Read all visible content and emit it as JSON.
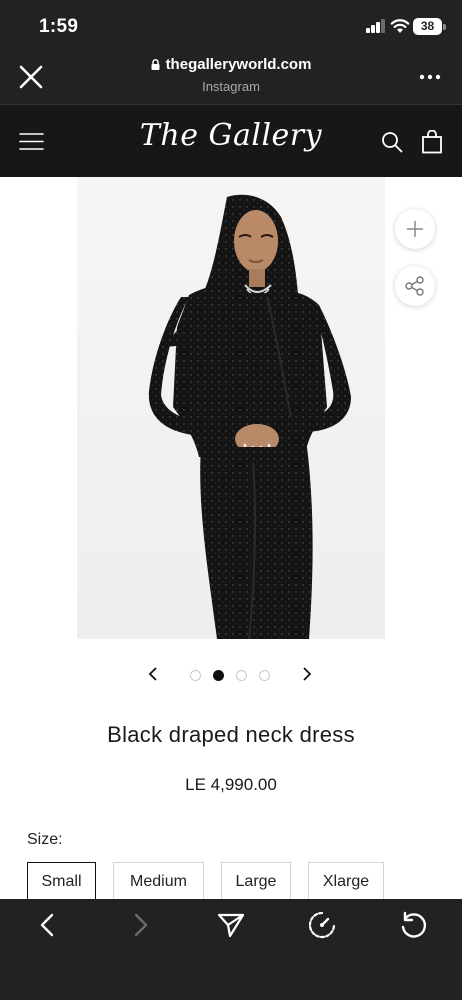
{
  "status_bar": {
    "time": "1:59",
    "battery": "38"
  },
  "browser": {
    "url": "thegalleryworld.com",
    "source": "Instagram"
  },
  "site": {
    "logo": "The Gallery"
  },
  "carousel": {
    "slide_count": 4,
    "active_index": 1
  },
  "product": {
    "title": "Black draped neck dress",
    "price": "LE 4,990.00",
    "size_label": "Size:",
    "sizes": [
      "Small",
      "Medium",
      "Large",
      "Xlarge"
    ],
    "selected_size": "Small"
  },
  "icons": {
    "close": "close-icon",
    "lock": "lock-icon",
    "more": "more-icon",
    "menu": "hamburger-icon",
    "search": "search-icon",
    "bag": "shopping-bag-icon",
    "zoom": "plus-icon",
    "share": "share-icon",
    "prev": "chevron-left-icon",
    "next": "chevron-right-icon",
    "back": "back-arrow-icon",
    "forward": "forward-arrow-icon",
    "send": "send-icon",
    "speed": "speedometer-icon",
    "reload": "reload-icon"
  },
  "colors": {
    "chrome": "#222224",
    "site_header": "#171717",
    "active_dot": "#111111"
  }
}
